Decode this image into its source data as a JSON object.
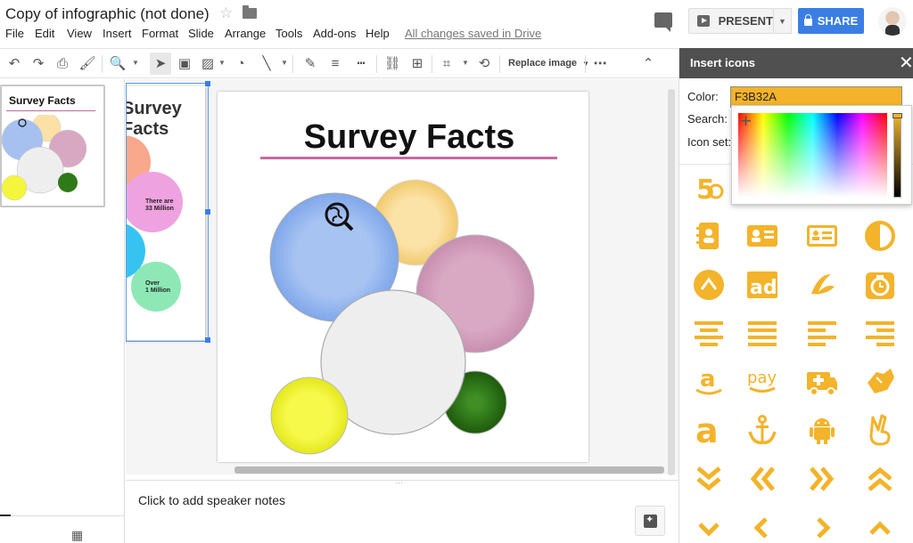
{
  "header": {
    "title": "Copy of infographic (not done)",
    "menu": [
      "File",
      "Edit",
      "View",
      "Insert",
      "Format",
      "Slide",
      "Arrange",
      "Tools",
      "Add-ons",
      "Help"
    ],
    "saved_status": "All changes saved in Drive",
    "present_label": "PRESENT",
    "share_label": "SHARE"
  },
  "toolbar": {
    "replace_image_label": "Replace image"
  },
  "filmstrip": {
    "slide_title": "Survey Facts"
  },
  "slide": {
    "title": "Survey Facts"
  },
  "notes": {
    "placeholder": "Click to add speaker notes"
  },
  "panel": {
    "title": "Insert icons",
    "color_label": "Color:",
    "color_value": "F3B32A",
    "search_label": "Search:",
    "iconset_label": "Icon set:",
    "accent_color": "#F3B32A",
    "icons": [
      [
        "500px-icon"
      ],
      [
        "address-book-icon",
        "address-card-icon",
        "id-card-icon",
        "adjust-icon"
      ],
      [
        "angle-circle-icon",
        "ad-icon",
        "adn-icon",
        "alarm-clock-icon"
      ],
      [
        "align-center-icon",
        "align-justify-icon",
        "align-left-icon",
        "align-right-icon"
      ],
      [
        "amazon-icon",
        "amazon-pay-icon",
        "ambulance-icon",
        "sign-language-icon"
      ],
      [
        "amazon-a-icon",
        "anchor-icon",
        "android-icon",
        "peace-hand-icon"
      ],
      [
        "angle-double-down-icon",
        "angle-double-left-icon",
        "angle-double-right-icon",
        "angle-double-up-icon"
      ],
      [
        "angle-down-icon",
        "angle-left-icon",
        "angle-right-icon",
        "angle-up-icon"
      ]
    ]
  },
  "prev_slide_snippets": {
    "text1": "There are",
    "text2": "33 Million",
    "text3": "Over",
    "text4": "1 Million"
  }
}
